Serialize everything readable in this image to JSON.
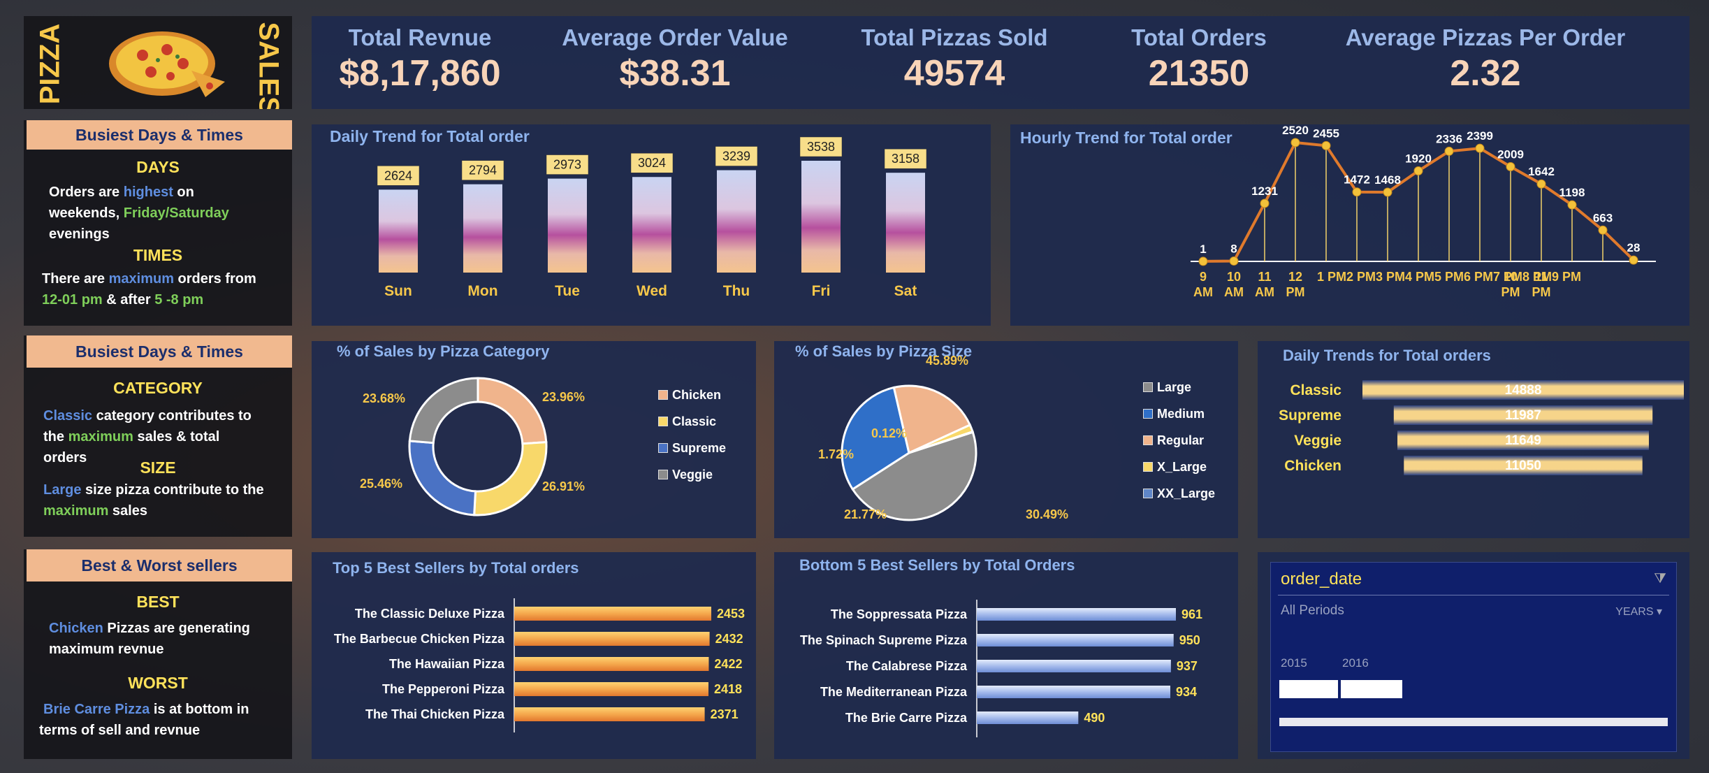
{
  "header": {
    "pizza": "PIZZA",
    "sales": "SALES"
  },
  "kpis": [
    {
      "label": "Total Revnue",
      "value": "$8,17,860"
    },
    {
      "label": "Average Order Value",
      "value": "$38.31"
    },
    {
      "label": "Total Pizzas Sold",
      "value": "49574"
    },
    {
      "label": "Total Orders",
      "value": "21350"
    },
    {
      "label": "Average Pizzas Per Order",
      "value": "2.32"
    }
  ],
  "insights": {
    "box1": {
      "title": "Busiest Days & Times",
      "sec1": "DAYS",
      "l1a": "Orders are ",
      "l1b": "highest",
      "l1c": " on",
      "l2a": "weekends, ",
      "l2b": "Friday/Saturday",
      "l3": "evenings",
      "sec2": "TIMES",
      "l4a": "There are ",
      "l4b": "maximum",
      "l4c": " orders from",
      "l5a": "12-01 pm",
      "l5b": " & after ",
      "l5c": "5 -8 pm"
    },
    "box2": {
      "title": "Busiest Days & Times",
      "sec1": "CATEGORY",
      "l1a": "Classic",
      "l1b": " category contributes to",
      "l2a": "the ",
      "l2b": "maximum",
      "l2c": " sales & total",
      "l3": "orders",
      "sec2": "SIZE",
      "l4a": "Large",
      "l4b": " size pizza contribute to the",
      "l5a": "maximum",
      "l5b": " sales"
    },
    "box3": {
      "title": "Best & Worst sellers",
      "sec1": "BEST",
      "l1a": "Chicken",
      "l1b": " Pizzas are generating",
      "l2": "maximum revnue",
      "sec2": "WORST",
      "l3a": "Brie Carre Pizza",
      "l3b": " is at bottom in",
      "l4": "terms of sell and revnue"
    }
  },
  "chart_data": [
    {
      "id": "daily",
      "type": "bar",
      "title": "Daily Trend for Total order",
      "categories": [
        "Sun",
        "Mon",
        "Tue",
        "Wed",
        "Thu",
        "Fri",
        "Sat"
      ],
      "values": [
        2624,
        2794,
        2973,
        3024,
        3239,
        3538,
        3158
      ]
    },
    {
      "id": "hourly",
      "type": "line",
      "title": "Hourly Trend for Total order",
      "categories": [
        "9 AM",
        "10 AM",
        "11 AM",
        "12 PM",
        "1 PM",
        "2 PM",
        "3 PM",
        "4 PM",
        "5 PM",
        "6 PM",
        "7 PM",
        "8 PM",
        "9 PM",
        "10 PM",
        "11 PM"
      ],
      "tick_lines": [
        [
          "9",
          "AM"
        ],
        [
          "10",
          "AM"
        ],
        [
          "11",
          "AM"
        ],
        [
          "12",
          "PM"
        ],
        [
          "1 PM2 PM3 PM4 PM5 PM6 PM7 PM8 PM9 PM",
          ""
        ],
        [
          "10",
          "PM"
        ],
        [
          "11",
          "PM"
        ]
      ],
      "values": [
        1,
        8,
        1231,
        2520,
        2455,
        1472,
        1468,
        1920,
        2336,
        2399,
        2009,
        1642,
        1198,
        663,
        28
      ]
    },
    {
      "id": "category",
      "type": "pie",
      "title": "% of Sales by Pizza Category",
      "labels": [
        "Chicken",
        "Classic",
        "Supreme",
        "Veggie"
      ],
      "values": [
        23.96,
        26.91,
        25.46,
        23.68
      ],
      "value_labels": [
        "23.96%",
        "26.91%",
        "25.46%",
        "23.68%"
      ],
      "colors": [
        "#f0b48c",
        "#f8d86a",
        "#4a72c4",
        "#8c8c8c"
      ]
    },
    {
      "id": "size",
      "type": "pie",
      "title": "% of Sales by Pizza Size",
      "labels": [
        "Large",
        "Medium",
        "Regular",
        "X_Large",
        "XX_Large"
      ],
      "values": [
        45.89,
        30.49,
        21.77,
        1.72,
        0.12
      ],
      "value_labels": [
        "45.89%",
        "30.49%",
        "21.77%",
        "1.72%",
        "0.12%"
      ],
      "colors": [
        "#8c8c8c",
        "#2f6fc8",
        "#f0b48c",
        "#f8d86a",
        "#5f86c8"
      ]
    },
    {
      "id": "cattrend",
      "type": "bar",
      "title": "Daily Trends for Total orders",
      "categories": [
        "Classic",
        "Supreme",
        "Veggie",
        "Chicken"
      ],
      "values": [
        14888,
        11987,
        11649,
        11050
      ]
    },
    {
      "id": "top5",
      "type": "bar",
      "title": "Top 5 Best Sellers by Total orders",
      "categories": [
        "The Classic Deluxe Pizza",
        "The Barbecue Chicken Pizza",
        "The Hawaiian Pizza",
        "The Pepperoni Pizza",
        "The Thai Chicken Pizza"
      ],
      "values": [
        2453,
        2432,
        2422,
        2418,
        2371
      ]
    },
    {
      "id": "bottom5",
      "type": "bar",
      "title": "Bottom 5 Best Sellers by Total Orders",
      "categories": [
        "The Soppressata Pizza",
        "The Spinach Supreme Pizza",
        "The Calabrese Pizza",
        "The Mediterranean Pizza",
        "The Brie Carre Pizza"
      ],
      "values": [
        961,
        950,
        937,
        934,
        490
      ]
    }
  ],
  "slicer": {
    "field": "order_date",
    "period": "All Periods",
    "level": "YEARS",
    "years": [
      "2015",
      "2016"
    ]
  }
}
